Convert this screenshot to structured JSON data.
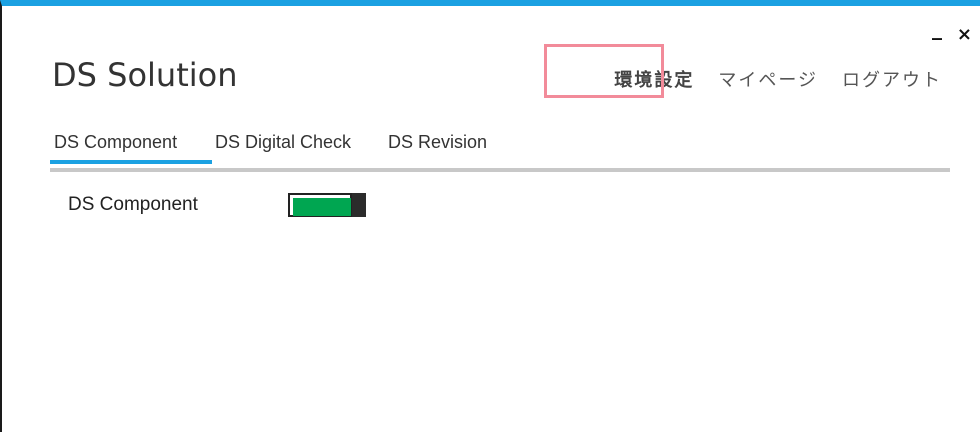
{
  "window": {
    "minimize_label": "_",
    "close_label": "×"
  },
  "app": {
    "title": "DS Solution"
  },
  "top_nav": {
    "settings": "環境設定",
    "mypage": "マイページ",
    "logout": "ログアウト"
  },
  "tabs": [
    {
      "label": "DS Component",
      "active": true
    },
    {
      "label": "DS Digital Check",
      "active": false
    },
    {
      "label": "DS Revision",
      "active": false
    }
  ],
  "settings_panel": {
    "row_label": "DS Component",
    "toggle_state": "on",
    "toggle_color": "#00a651"
  },
  "colors": {
    "accent": "#1ba1e2",
    "highlight": "#f28b9a"
  }
}
